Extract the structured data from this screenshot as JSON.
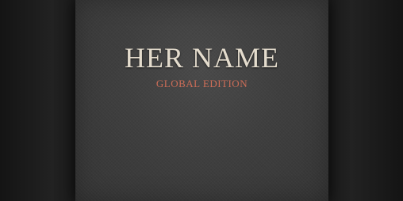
{
  "book": {
    "title": "HER NAME",
    "subtitle": "GLOBAL EDITION"
  },
  "colors": {
    "background": "#1c1c1c",
    "cover": "#404040",
    "title": "#e4dccd",
    "subtitle": "#cd6d57"
  }
}
